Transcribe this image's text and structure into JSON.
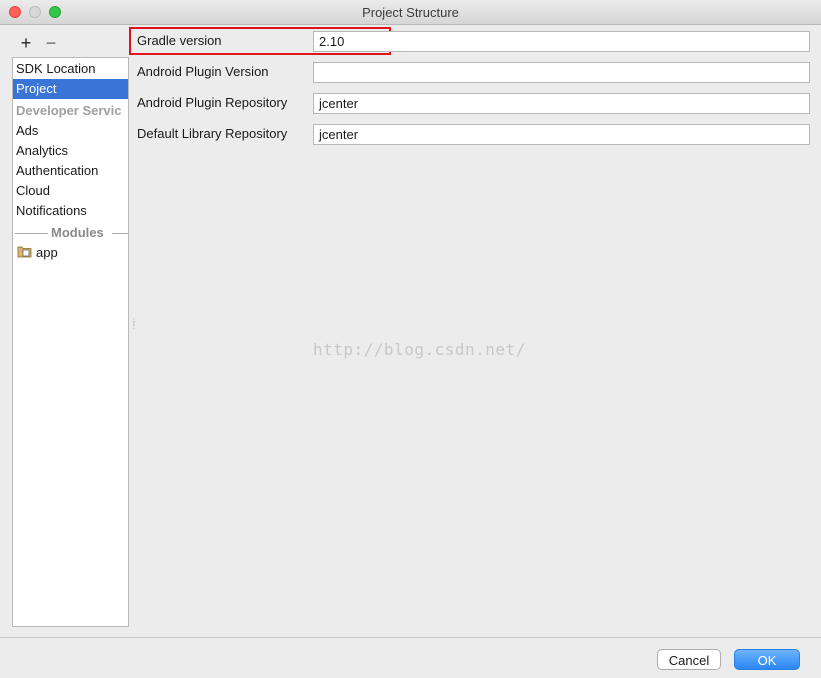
{
  "window": {
    "title": "Project Structure"
  },
  "toolbar": {
    "add_label": "+",
    "remove_label": "−"
  },
  "sidebar": {
    "items": [
      {
        "label": "SDK Location",
        "selected": false
      },
      {
        "label": "Project",
        "selected": true
      }
    ],
    "services_header": "Developer Servic",
    "services": [
      "Ads",
      "Analytics",
      "Authentication",
      "Cloud",
      "Notifications"
    ],
    "modules_header": "Modules",
    "modules": [
      {
        "label": "app",
        "icon": "module-folder-icon"
      }
    ]
  },
  "fields": [
    {
      "label": "Gradle version",
      "value": "2.10"
    },
    {
      "label": "Android Plugin Version",
      "value": ""
    },
    {
      "label": "Android Plugin Repository",
      "value": "jcenter"
    },
    {
      "label": "Default Library Repository",
      "value": "jcenter"
    }
  ],
  "watermark": "http://blog.csdn.net/",
  "buttons": {
    "cancel": "Cancel",
    "ok": "OK"
  },
  "colors": {
    "selection": "#3875d7",
    "highlight_box": "#e0141b",
    "ok_button": "#2c86f4"
  }
}
